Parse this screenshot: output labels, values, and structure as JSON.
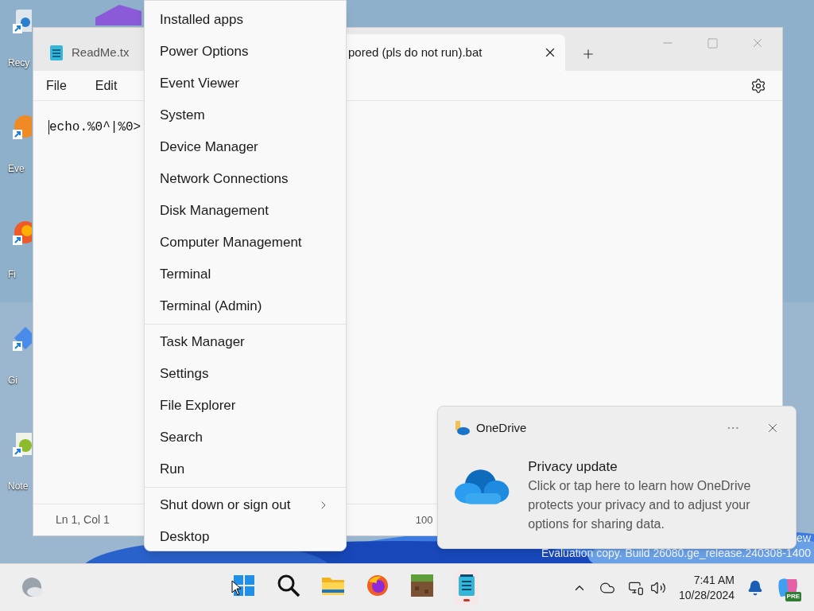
{
  "desktop": {
    "icons": [
      {
        "kind": "bin",
        "label": "Recy"
      },
      {
        "kind": "orange",
        "label": "Eve"
      },
      {
        "kind": "fox",
        "label": "Fi"
      },
      {
        "kind": "diamond",
        "label": "Gi"
      },
      {
        "kind": "note",
        "label": "Note"
      }
    ],
    "watermark": [
      "ew",
      "Evaluation copy. Build 26080.ge_release.240308-1400"
    ]
  },
  "notepad": {
    "tabs": [
      {
        "title": "ReadMe.tx",
        "selected": false
      },
      {
        "title": "pored (pls do not run).bat",
        "selected": true
      }
    ],
    "menu": [
      "File",
      "Edit"
    ],
    "text": "echo.%0^|%0>",
    "status": [
      "Ln 1, Col 1",
      "100"
    ]
  },
  "context_menu": {
    "groups": [
      [
        {
          "label": "Installed apps",
          "submenu": false
        },
        {
          "label": "Power Options",
          "submenu": false
        },
        {
          "label": "Event Viewer",
          "submenu": false
        },
        {
          "label": "System",
          "submenu": false
        },
        {
          "label": "Device Manager",
          "submenu": false
        },
        {
          "label": "Network Connections",
          "submenu": false
        },
        {
          "label": "Disk Management",
          "submenu": false
        },
        {
          "label": "Computer Management",
          "submenu": false
        },
        {
          "label": "Terminal",
          "submenu": false
        },
        {
          "label": "Terminal (Admin)",
          "submenu": false
        }
      ],
      [
        {
          "label": "Task Manager",
          "submenu": false
        },
        {
          "label": "Settings",
          "submenu": false
        },
        {
          "label": "File Explorer",
          "submenu": false
        },
        {
          "label": "Search",
          "submenu": false
        },
        {
          "label": "Run",
          "submenu": false
        }
      ],
      [
        {
          "label": "Shut down or sign out",
          "submenu": true
        },
        {
          "label": "Desktop",
          "submenu": false
        }
      ]
    ]
  },
  "toast": {
    "app": "OneDrive",
    "title": "Privacy update",
    "body": "Click or tap here to learn how OneDrive protects your privacy and to adjust your options for sharing data."
  },
  "taskbar": {
    "apps": [
      {
        "kind": "start",
        "active": false
      },
      {
        "kind": "search",
        "active": false
      },
      {
        "kind": "explorer",
        "active": false
      },
      {
        "kind": "firefox",
        "active": false
      },
      {
        "kind": "minecraft",
        "active": false
      },
      {
        "kind": "notepad",
        "active": true
      }
    ],
    "time": "7:41 AM",
    "date": "10/28/2024",
    "badge": "PRE"
  }
}
